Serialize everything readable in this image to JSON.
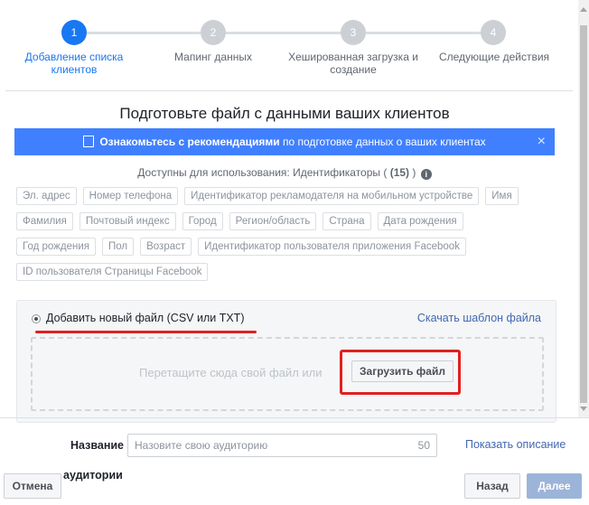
{
  "stepper": {
    "steps": [
      {
        "number": "1",
        "label": "Добавление списка клиентов",
        "state": "active"
      },
      {
        "number": "2",
        "label": "Мапинг данных",
        "state": "inactive"
      },
      {
        "number": "3",
        "label": "Хешированная загрузка и создание",
        "state": "inactive"
      },
      {
        "number": "4",
        "label": "Следующие действия",
        "state": "inactive"
      }
    ]
  },
  "main": {
    "title": "Подготовьте файл с данными ваших клиентов",
    "banner": {
      "link_text": "Ознакомьтесь с рекомендациями",
      "rest_text": " по подготовке данных о ваших клиентах",
      "close": "×"
    },
    "available": {
      "prefix": "Доступны для использования: Идентификаторы ( ",
      "count": "(15)",
      "suffix": " )"
    },
    "identifiers": [
      [
        "Эл. адрес",
        "Номер телефона",
        "Идентификатор рекламодателя на мобильном устройстве",
        "Имя"
      ],
      [
        "Фамилия",
        "Почтовый индекс",
        "Город",
        "Регион/область",
        "Страна",
        "Дата рождения"
      ],
      [
        "Год рождения",
        "Пол",
        "Возраст",
        "Идентификатор пользователя приложения Facebook"
      ],
      [
        "ID пользователя Страницы Facebook"
      ]
    ]
  },
  "upload": {
    "add_file_label": "Добавить новый файл (CSV или TXT)",
    "template_link": "Скачать шаблон файла",
    "drop_text": "Перетащите сюда свой файл или",
    "upload_button": "Загрузить файл"
  },
  "footer": {
    "name_label": "Название",
    "name_placeholder": "Назовите свою аудиторию",
    "name_counter": "50",
    "show_description": "Показать описание",
    "audience_label": "аудитории",
    "cancel": "Отмена",
    "back": "Назад",
    "next": "Далее"
  },
  "colors": {
    "accent": "#1877f2",
    "banner": "#4080ff",
    "highlight": "#e02020",
    "link": "#4267b2"
  }
}
